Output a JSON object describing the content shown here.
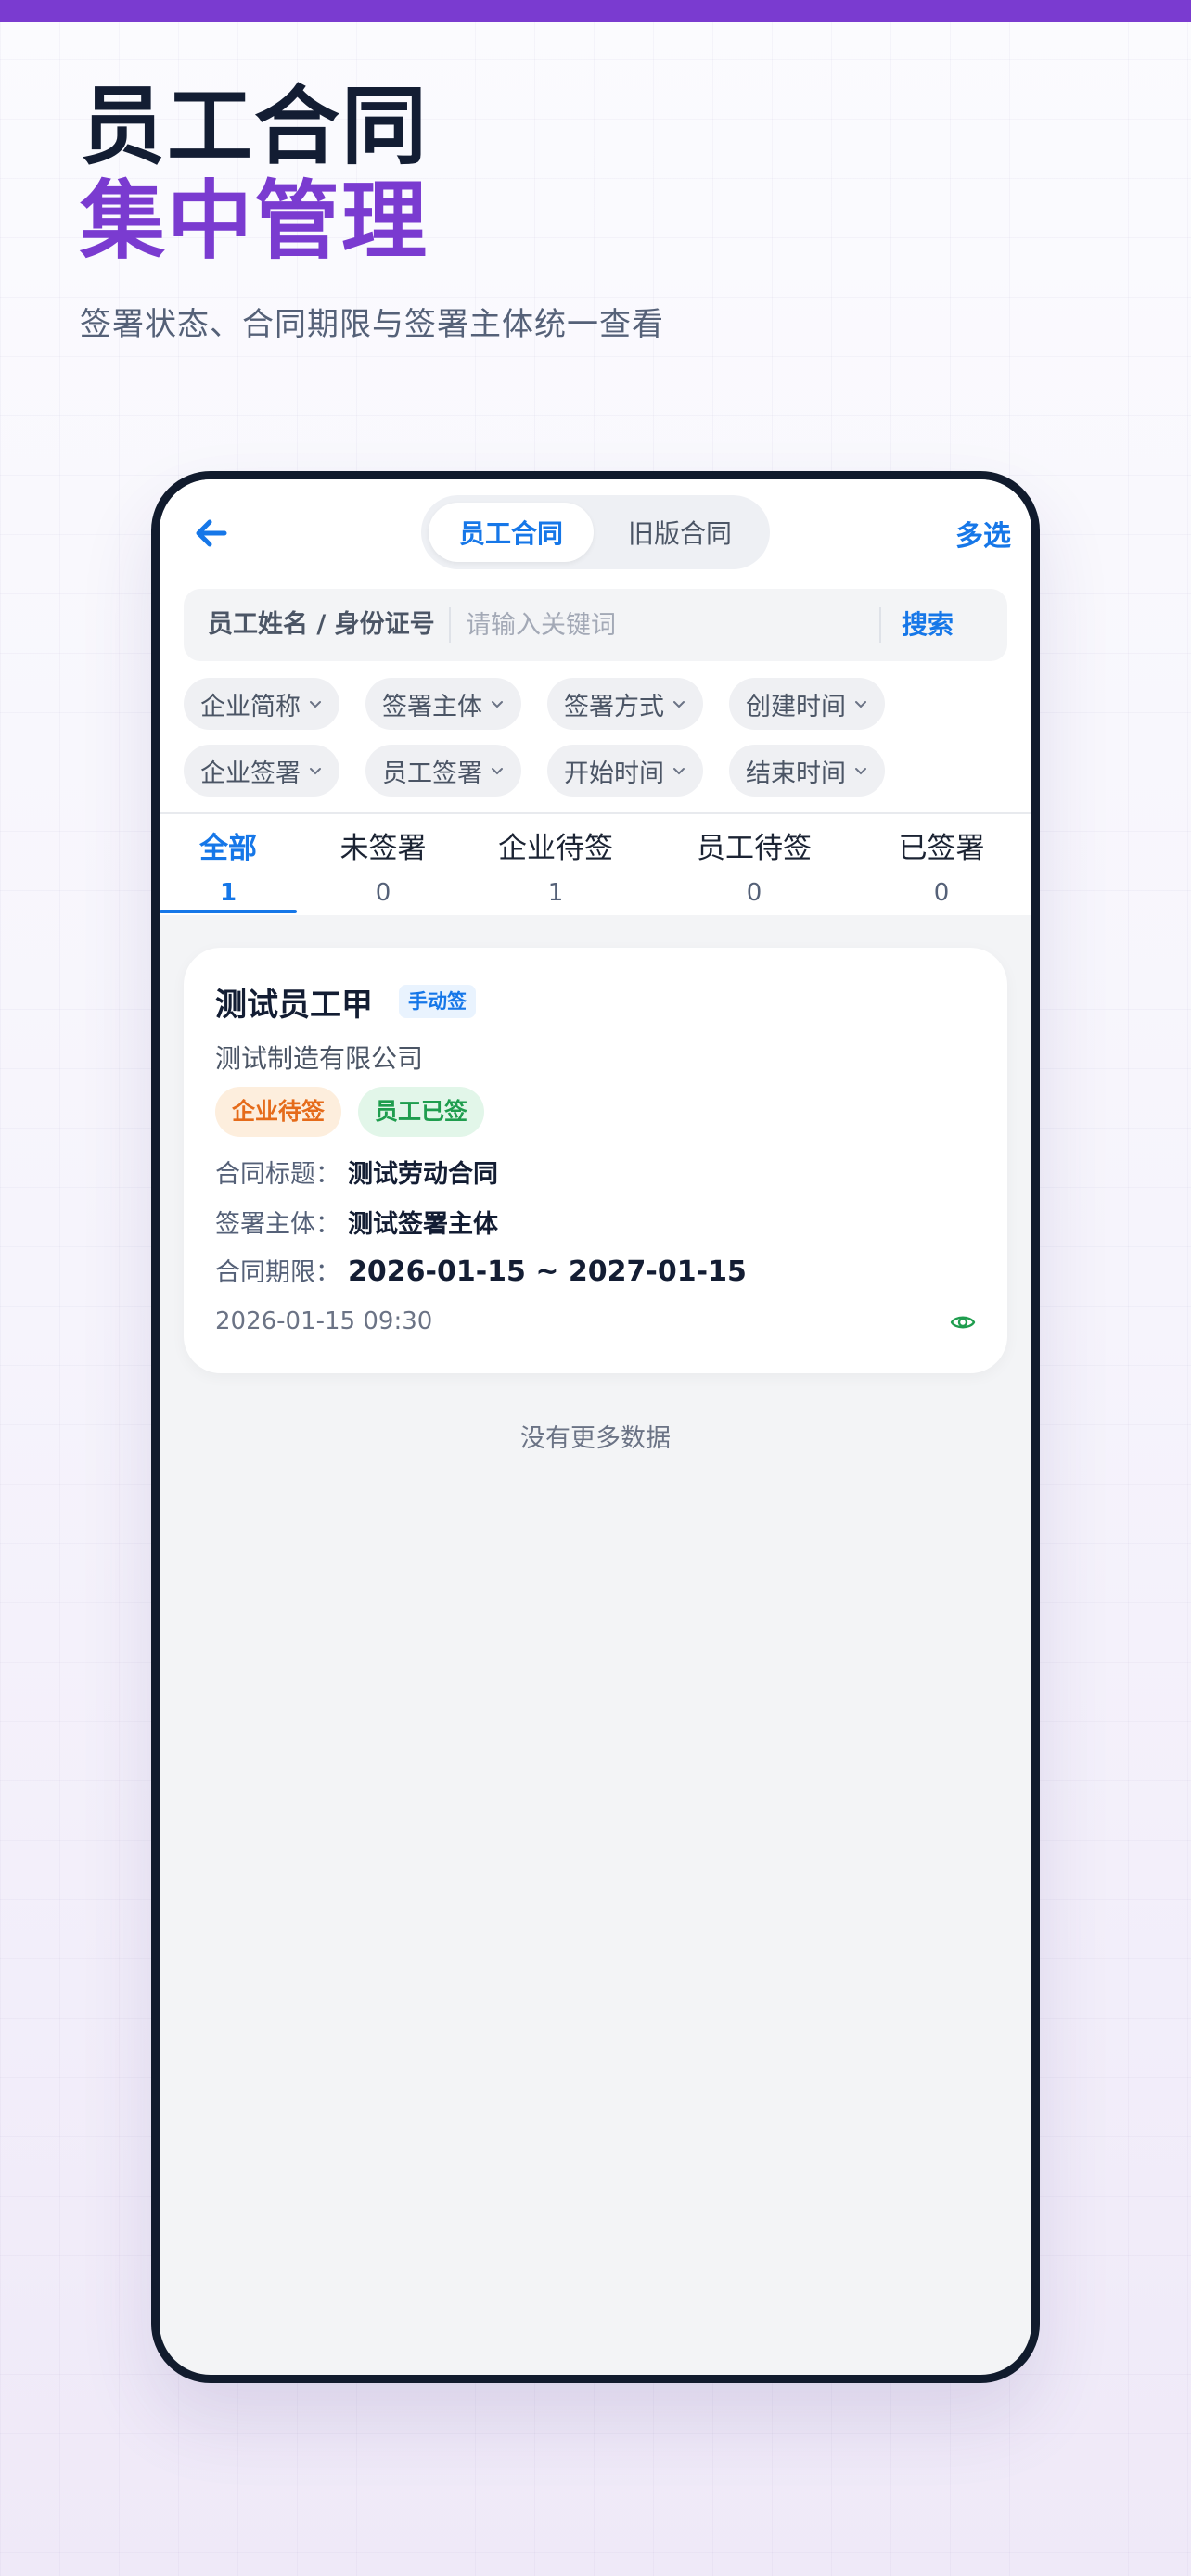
{
  "promo": {
    "title_line1": "员工合同",
    "title_line2": "集中管理",
    "subtitle": "签署状态、合同期限与签署主体统一查看"
  },
  "colors": {
    "accent": "#7a3bd0",
    "primary": "#1677e8",
    "dark": "#131d33"
  },
  "nav": {
    "back_icon": "arrow-left-icon",
    "segments": [
      "员工合同",
      "旧版合同"
    ],
    "active_segment": "员工合同",
    "multi_select": "多选"
  },
  "search": {
    "label": "员工姓名 / 身份证号",
    "placeholder": "请输入关键词",
    "value": "",
    "button": "搜索"
  },
  "filters": {
    "row1": [
      "企业简称",
      "签署主体",
      "签署方式",
      "创建时间"
    ],
    "row2": [
      "企业签署",
      "员工签署",
      "开始时间",
      "结束时间"
    ]
  },
  "tabs": [
    {
      "label": "全部",
      "count": "1",
      "active": true
    },
    {
      "label": "未签署",
      "count": "0",
      "active": false
    },
    {
      "label": "企业待签",
      "count": "1",
      "active": false
    },
    {
      "label": "员工待签",
      "count": "0",
      "active": false
    },
    {
      "label": "已签署",
      "count": "0",
      "active": false
    }
  ],
  "contracts": [
    {
      "employee": "测试员工甲",
      "sign_mode": "手动签",
      "company": "测试制造有限公司",
      "statuses": [
        "企业待签",
        "员工已签"
      ],
      "fields": [
        {
          "label": "合同标题：",
          "value": "测试劳动合同"
        },
        {
          "label": "签署主体：",
          "value": "测试签署主体"
        },
        {
          "label": "合同期限：",
          "value": "2026-01-15 ~ 2027-01-15"
        }
      ],
      "created": "2026-01-15 09:30",
      "view_icon": "eye-icon"
    }
  ],
  "footer_text": "没有更多数据"
}
